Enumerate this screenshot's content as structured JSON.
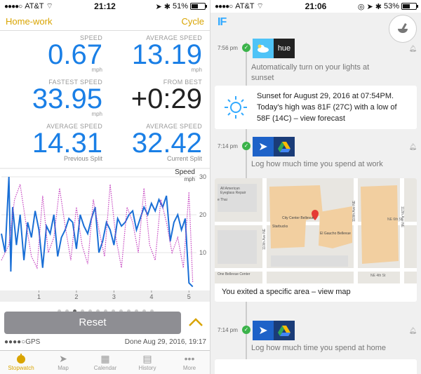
{
  "left": {
    "status": {
      "carrier": "AT&T",
      "time": "21:12",
      "battery": "51%",
      "battery_level": 0.51
    },
    "nav": {
      "left": "Home-work",
      "right": "Cycle"
    },
    "metrics": [
      {
        "label": "SPEED",
        "value": "0.67",
        "unit": "mph",
        "sub": ""
      },
      {
        "label": "AVERAGE SPEED",
        "value": "13.19",
        "unit": "mph",
        "sub": ""
      },
      {
        "label": "FASTEST SPEED",
        "value": "33.95",
        "unit": "mph",
        "sub": ""
      },
      {
        "label": "FROM BEST",
        "value": "+0:29",
        "unit": "",
        "sub": ""
      },
      {
        "label": "AVERAGE SPEED",
        "value": "14.31",
        "unit": "",
        "sub": "Previous Split"
      },
      {
        "label": "AVERAGE SPEED",
        "value": "32.42",
        "unit": "",
        "sub": "Current Split"
      }
    ],
    "chart": {
      "title": "Speed",
      "unit": "mph"
    },
    "reset_label": "Reset",
    "gps_label": "GPS",
    "done_label": "Done Aug 29, 2016, 19:17",
    "tabs": [
      "Stopwatch",
      "Map",
      "Calendar",
      "History",
      "More"
    ]
  },
  "chart_data": {
    "type": "line",
    "title": "Speed",
    "ylabel": "mph",
    "xlim": [
      0,
      5.2
    ],
    "ylim": [
      0,
      30
    ],
    "xticks": [
      1,
      2,
      3,
      4,
      5
    ],
    "yticks": [
      10,
      20,
      30
    ],
    "series": [
      {
        "color": "#1a6fd6",
        "style": "solid",
        "x": [
          0.0,
          0.1,
          0.2,
          0.25,
          0.3,
          0.4,
          0.5,
          0.6,
          0.7,
          0.8,
          0.9,
          1.0,
          1.1,
          1.2,
          1.3,
          1.4,
          1.5,
          1.6,
          1.7,
          1.8,
          1.9,
          2.0,
          2.1,
          2.2,
          2.3,
          2.4,
          2.5,
          2.6,
          2.7,
          2.8,
          2.9,
          3.0,
          3.1,
          3.2,
          3.3,
          3.4,
          3.5,
          3.6,
          3.7,
          3.8,
          3.9,
          4.0,
          4.1,
          4.2,
          4.3,
          4.4,
          4.5,
          4.6,
          4.7,
          4.8,
          4.9,
          5.0,
          5.1
        ],
        "y": [
          15,
          10,
          30,
          5,
          22,
          12,
          20,
          8,
          18,
          14,
          21,
          16,
          6,
          17,
          15,
          20,
          9,
          14,
          16,
          19,
          18,
          11,
          20,
          17,
          15,
          19,
          22,
          10,
          13,
          18,
          16,
          12,
          19,
          17,
          18,
          20,
          21,
          16,
          19,
          22,
          20,
          23,
          21,
          24,
          22,
          25,
          13,
          18,
          20,
          16,
          19,
          2,
          1
        ]
      },
      {
        "color": "#c43fbf",
        "style": "dotted",
        "x": [
          0.0,
          0.2,
          0.35,
          0.5,
          0.65,
          0.8,
          0.95,
          1.1,
          1.25,
          1.4,
          1.55,
          1.7,
          1.85,
          2.0,
          2.15,
          2.3,
          2.45,
          2.6,
          2.75,
          2.9,
          3.05,
          3.2,
          3.35,
          3.5,
          3.65,
          3.8,
          3.95,
          4.1,
          4.25,
          4.4,
          4.55,
          4.7,
          4.85,
          5.0,
          5.1
        ],
        "y": [
          8,
          12,
          24,
          28,
          18,
          9,
          6,
          25,
          10,
          14,
          27,
          17,
          8,
          22,
          12,
          7,
          24,
          16,
          9,
          28,
          14,
          6,
          22,
          18,
          10,
          27,
          12,
          8,
          24,
          18,
          10,
          14,
          6,
          26,
          2
        ]
      }
    ]
  },
  "right": {
    "status": {
      "carrier": "AT&T",
      "time": "21:06",
      "battery": "53%",
      "battery_level": 0.53
    },
    "logo": "IF",
    "items": [
      {
        "time": "7:56 pm",
        "text": "Automatically turn on your lights at sunset",
        "icon_b": "hue"
      },
      {
        "time": "7:14 pm",
        "text": "Log how much time you spend at work"
      },
      {
        "time": "7:14 pm",
        "text": "Log how much time you spend at home"
      }
    ],
    "sunset_card": "Sunset for August 29, 2016 at 07:54PM. Today's high was 81F (27C) with a low of 58F (14C) – view forecast",
    "map_card": "You exited a specific area – view map",
    "map_labels": [
      "All American",
      "Eyeglass Repair",
      "e Thai",
      "City Center Bellevue",
      "Starbucks",
      "El Gaucho Bellevue",
      "110th Ave NE",
      "110th Ave NE",
      "NE 6th St",
      "One Bellevue Center",
      "NE 4th St",
      "112th Ave NE"
    ]
  }
}
